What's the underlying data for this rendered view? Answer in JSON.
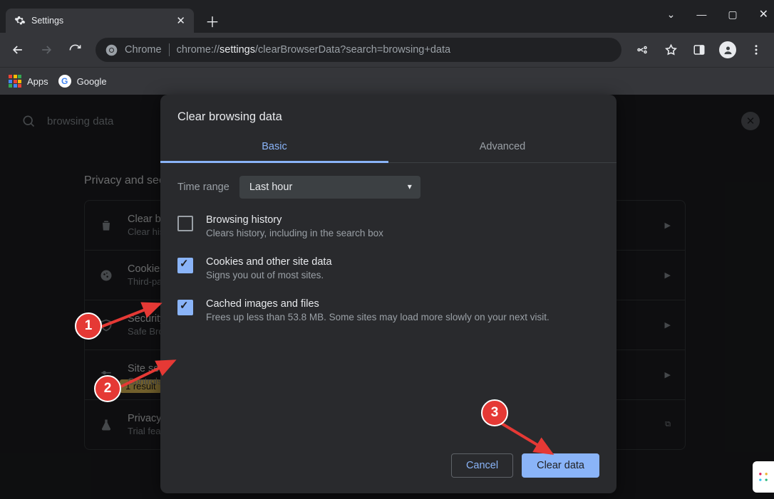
{
  "window": {
    "tab_title": "Settings"
  },
  "omnibox": {
    "scheme_label": "Chrome",
    "url_pre": "chrome://",
    "url_bold": "settings",
    "url_post": "/clearBrowserData?search=browsing+data"
  },
  "bookmarks": {
    "apps": "Apps",
    "google": "Google"
  },
  "page": {
    "search_value": "browsing data",
    "section_heading": "Privacy and security",
    "result_badge": "1 result",
    "cards": [
      {
        "icon": "trash",
        "title": "Clear browsing data",
        "sub": "Clear history, cookies, cache, and more"
      },
      {
        "icon": "cookie",
        "title": "Cookies and other site data",
        "sub": "Third-party cookies are blocked"
      },
      {
        "icon": "shield",
        "title": "Security",
        "sub": "Safe Browsing and other settings"
      },
      {
        "icon": "sliders",
        "title": "Site settings",
        "sub": "Controls what sites can use"
      },
      {
        "icon": "flask",
        "title": "Privacy Sandbox",
        "sub": "Trial features are on"
      }
    ]
  },
  "dialog": {
    "title": "Clear browsing data",
    "tab_basic": "Basic",
    "tab_advanced": "Advanced",
    "time_range_label": "Time range",
    "time_range_value": "Last hour",
    "options": [
      {
        "checked": false,
        "title": "Browsing history",
        "desc": "Clears history, including in the search box"
      },
      {
        "checked": true,
        "title": "Cookies and other site data",
        "desc": "Signs you out of most sites."
      },
      {
        "checked": true,
        "title": "Cached images and files",
        "desc": "Frees up less than 53.8 MB. Some sites may load more slowly on your next visit."
      }
    ],
    "cancel": "Cancel",
    "clear": "Clear data"
  },
  "annotations": {
    "b1": "1",
    "b2": "2",
    "b3": "3"
  }
}
